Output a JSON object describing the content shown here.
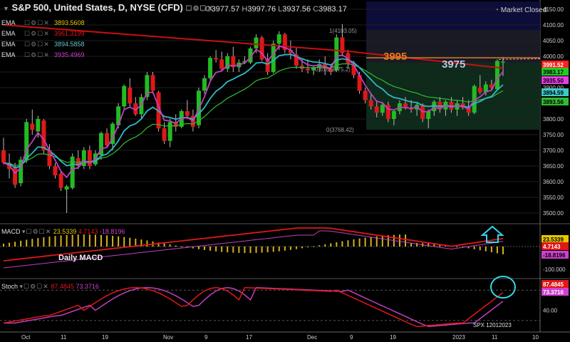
{
  "header": {
    "title": "S&P 500, United States, D, NYSE (CFD)",
    "ohlc": {
      "o": "3977.57",
      "h": "3997.76",
      "l": "3937.56",
      "c": "3983.17"
    },
    "market_status": "Market Closed"
  },
  "ema_rows": [
    {
      "label": "EMA",
      "value": "3893.5608",
      "color": "#e6c800"
    },
    {
      "label": "EMA",
      "value": "3961.3199",
      "color": "#e01818"
    },
    {
      "label": "EMA",
      "value": "3894.5858",
      "color": "#5ec8d0"
    },
    {
      "label": "EMA",
      "value": "3935.4969",
      "color": "#d040d0"
    }
  ],
  "macd": {
    "label": "MACD",
    "values": [
      "23.5339",
      "4.7143",
      "-18.8196"
    ],
    "annotation": "Daily MACD",
    "ticks": [
      "0.00",
      "-100.000"
    ],
    "tags": [
      "23.5339",
      "4.7143",
      "-18.8196"
    ]
  },
  "stoch": {
    "label": "Stoch",
    "values": [
      "87.4845",
      "73.3716"
    ],
    "ticks": [
      "40.00"
    ],
    "tags": [
      "87.4845",
      "73.3716"
    ],
    "footer": "SPX 12012023"
  },
  "annotations": {
    "level_3995": "3995",
    "level_3975": "3975",
    "fib_top": "1(4103.05)",
    "fib_mid": "0.618(3975.2)",
    "fib_bottom": "0(3768.42)"
  },
  "chart_data": {
    "type": "candlestick",
    "title": "S&P 500, United States, D, NYSE (CFD)",
    "x_ticks": [
      "Oct",
      "11",
      "19",
      "Nov",
      "9",
      "17",
      "Dec",
      "9",
      "19",
      "2023",
      "11",
      "10"
    ],
    "y_ticks": [
      4150,
      4100,
      4050,
      4000,
      3950,
      3900,
      3850,
      3800,
      3750,
      3700,
      3650,
      3600,
      3550,
      3500
    ],
    "ylim": [
      3468,
      4175
    ],
    "price_tags": [
      {
        "label": "3991.52",
        "color": "#ff2020"
      },
      {
        "label": "3983.17",
        "color": "#22cc22"
      },
      {
        "label": "3935.50",
        "color": "#e040e0"
      },
      {
        "label": "3894.59",
        "color": "#40c8c8"
      },
      {
        "label": "3893.56",
        "color": "#33bb33"
      }
    ],
    "candles": [
      [
        3700,
        3740,
        3655,
        3660
      ],
      [
        3660,
        3690,
        3610,
        3640
      ],
      [
        3645,
        3660,
        3580,
        3590
      ],
      [
        3595,
        3680,
        3585,
        3670
      ],
      [
        3670,
        3800,
        3660,
        3790
      ],
      [
        3785,
        3830,
        3750,
        3765
      ],
      [
        3760,
        3810,
        3740,
        3800
      ],
      [
        3795,
        3800,
        3690,
        3700
      ],
      [
        3700,
        3720,
        3640,
        3650
      ],
      [
        3650,
        3660,
        3610,
        3620
      ],
      [
        3625,
        3635,
        3570,
        3580
      ],
      [
        3575,
        3590,
        3500,
        3585
      ],
      [
        3580,
        3690,
        3575,
        3680
      ],
      [
        3675,
        3700,
        3640,
        3650
      ],
      [
        3650,
        3710,
        3640,
        3700
      ],
      [
        3700,
        3715,
        3640,
        3650
      ],
      [
        3655,
        3700,
        3650,
        3690
      ],
      [
        3685,
        3760,
        3670,
        3755
      ],
      [
        3755,
        3770,
        3710,
        3715
      ],
      [
        3720,
        3790,
        3700,
        3785
      ],
      [
        3780,
        3850,
        3770,
        3840
      ],
      [
        3840,
        3910,
        3830,
        3905
      ],
      [
        3900,
        3930,
        3840,
        3850
      ],
      [
        3850,
        3870,
        3810,
        3815
      ],
      [
        3815,
        3880,
        3800,
        3870
      ],
      [
        3870,
        3950,
        3860,
        3940
      ],
      [
        3940,
        3950,
        3880,
        3890
      ],
      [
        3885,
        3890,
        3760,
        3770
      ],
      [
        3770,
        3790,
        3720,
        3730
      ],
      [
        3730,
        3800,
        3710,
        3790
      ],
      [
        3790,
        3815,
        3760,
        3775
      ],
      [
        3775,
        3830,
        3770,
        3825
      ],
      [
        3825,
        3860,
        3800,
        3810
      ],
      [
        3810,
        3830,
        3760,
        3775
      ],
      [
        3780,
        3900,
        3770,
        3890
      ],
      [
        3890,
        3940,
        3880,
        3930
      ],
      [
        3930,
        4000,
        3920,
        3995
      ],
      [
        3995,
        4020,
        3980,
        3990
      ],
      [
        3990,
        4015,
        3955,
        3960
      ],
      [
        3960,
        4010,
        3950,
        4000
      ],
      [
        4000,
        4030,
        3950,
        3965
      ],
      [
        3965,
        3990,
        3950,
        3980
      ],
      [
        3980,
        4000,
        3975,
        3985
      ],
      [
        3980,
        4030,
        3975,
        4025
      ],
      [
        4025,
        4070,
        4010,
        4060
      ],
      [
        4060,
        4065,
        3985,
        3990
      ],
      [
        3990,
        4010,
        3940,
        3950
      ],
      [
        3950,
        4050,
        3945,
        4040
      ],
      [
        4040,
        4080,
        4020,
        4070
      ],
      [
        4070,
        4075,
        4010,
        4020
      ],
      [
        4020,
        4050,
        3990,
        4010
      ],
      [
        4005,
        4030,
        3960,
        3970
      ],
      [
        3970,
        3990,
        3950,
        3960
      ],
      [
        3960,
        3990,
        3945,
        3955
      ],
      [
        3955,
        3970,
        3940,
        3965
      ],
      [
        3965,
        3990,
        3950,
        3975
      ],
      [
        3975,
        4000,
        3940,
        3960
      ],
      [
        3960,
        3970,
        3940,
        3950
      ],
      [
        3955,
        4070,
        3950,
        4060
      ],
      [
        4060,
        4103,
        4000,
        4010
      ],
      [
        4010,
        4020,
        3960,
        3975
      ],
      [
        3975,
        3985,
        3930,
        3940
      ],
      [
        3940,
        3950,
        3880,
        3890
      ],
      [
        3890,
        3900,
        3850,
        3860
      ],
      [
        3860,
        3880,
        3830,
        3840
      ],
      [
        3840,
        3860,
        3805,
        3820
      ],
      [
        3820,
        3850,
        3810,
        3845
      ],
      [
        3845,
        3855,
        3790,
        3800
      ],
      [
        3800,
        3830,
        3780,
        3825
      ],
      [
        3825,
        3860,
        3815,
        3850
      ],
      [
        3850,
        3870,
        3830,
        3835
      ],
      [
        3835,
        3860,
        3820,
        3830
      ],
      [
        3830,
        3850,
        3810,
        3845
      ],
      [
        3845,
        3850,
        3790,
        3800
      ],
      [
        3800,
        3830,
        3770,
        3825
      ],
      [
        3825,
        3860,
        3810,
        3855
      ],
      [
        3855,
        3870,
        3820,
        3830
      ],
      [
        3830,
        3860,
        3810,
        3855
      ],
      [
        3855,
        3870,
        3820,
        3830
      ],
      [
        3830,
        3860,
        3810,
        3850
      ],
      [
        3850,
        3870,
        3830,
        3835
      ],
      [
        3835,
        3860,
        3810,
        3820
      ],
      [
        3820,
        3910,
        3815,
        3905
      ],
      [
        3900,
        3940,
        3880,
        3885
      ],
      [
        3885,
        3920,
        3875,
        3910
      ],
      [
        3910,
        3925,
        3890,
        3900
      ],
      [
        3895,
        3990,
        3890,
        3985
      ],
      [
        3980,
        3998,
        3937,
        3983
      ]
    ]
  }
}
